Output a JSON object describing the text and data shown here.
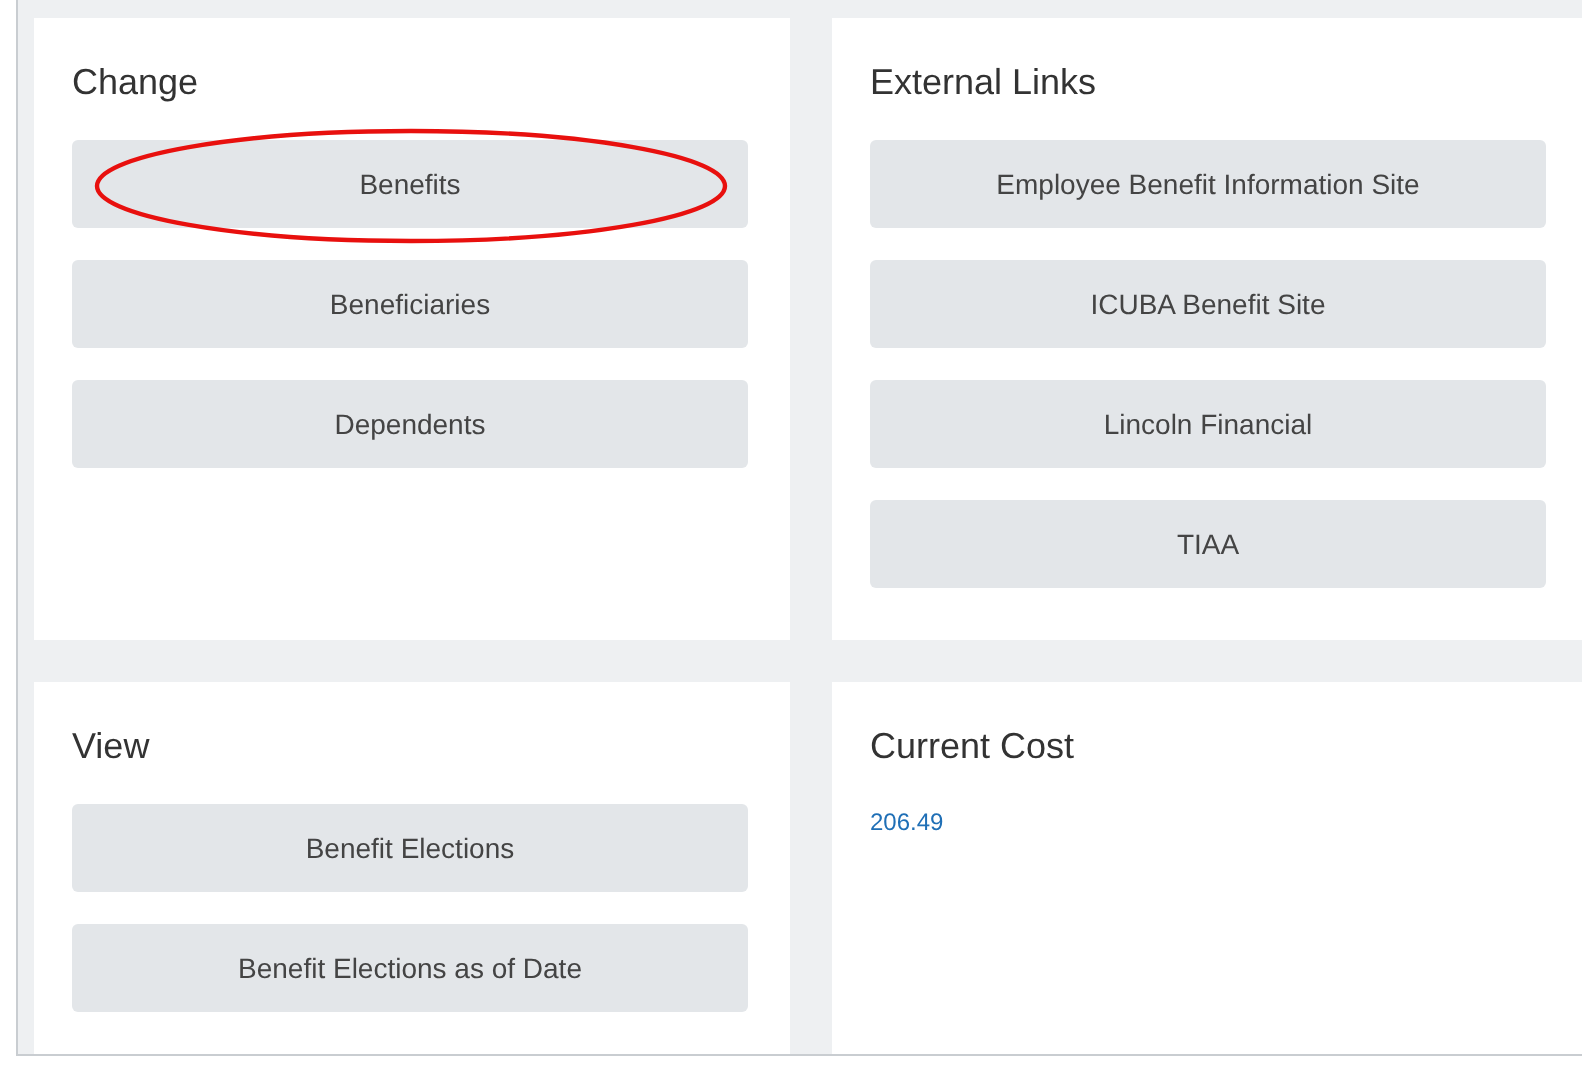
{
  "cards": [
    {
      "title": "Change",
      "kind": "buttons",
      "buttons": [
        {
          "label": "Benefits",
          "circled": true
        },
        {
          "label": "Beneficiaries",
          "circled": false
        },
        {
          "label": "Dependents",
          "circled": false
        }
      ]
    },
    {
      "title": "External Links",
      "kind": "buttons",
      "buttons": [
        {
          "label": "Employee Benefit Information Site",
          "circled": false
        },
        {
          "label": "ICUBA Benefit Site",
          "circled": false
        },
        {
          "label": "Lincoln Financial",
          "circled": false
        },
        {
          "label": "TIAA",
          "circled": false
        }
      ]
    },
    {
      "title": "View",
      "kind": "buttons",
      "buttons": [
        {
          "label": "Benefit Elections",
          "circled": false
        },
        {
          "label": "Benefit Elections as of Date",
          "circled": false
        }
      ]
    },
    {
      "title": "Current Cost",
      "kind": "value",
      "value": "206.49"
    }
  ]
}
